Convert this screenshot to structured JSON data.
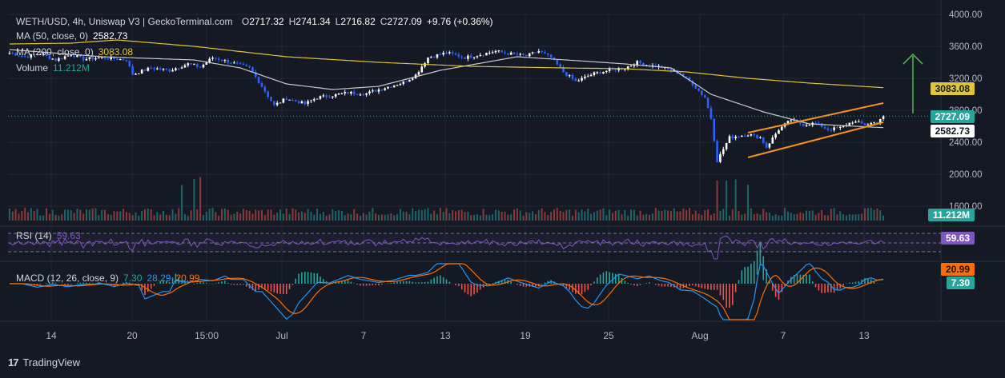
{
  "header": {
    "symbol": "WETH/USD, 4h, Uniswap V3 | GeckoTerminal.com",
    "open_label": "O",
    "open": "2717.32",
    "high_label": "H",
    "high": "2741.34",
    "low_label": "L",
    "low": "2716.82",
    "close_label": "C",
    "close": "2727.09",
    "change": "+9.76 (+0.36%)"
  },
  "legends": {
    "ma50_name": "MA (50, close, 0)",
    "ma50_value": "2582.73",
    "ma200_name": "MA (200, close, 0)",
    "ma200_value": "3083.08",
    "volume_name": "Volume",
    "volume_value": "11.212M",
    "rsi_name": "RSI (14)",
    "rsi_value": "59.63",
    "macd_name": "MACD (12, 26, close, 9)",
    "macd_value": "7.30",
    "signal_value": "28.29",
    "hist_value": "20.99"
  },
  "badges": {
    "ma200": "3083.08",
    "last": "2727.09",
    "ma50": "2582.73",
    "volume": "11.212M",
    "rsi": "59.63",
    "macd_a": "20.99",
    "macd_b": "7.30"
  },
  "brand": {
    "name": "TradingView"
  },
  "colors": {
    "background": "#151924",
    "up": "#ffffff",
    "down": "#2962ff",
    "ma50": "#c8c8c8",
    "ma200": "#e0c43a",
    "channel": "#f7931a",
    "arrow": "#4caf50",
    "rsi": "#7e57c2",
    "macd": "#2196f3",
    "signal": "#ff6d00",
    "hist_up": "#26a69a",
    "hist_down": "#ef5350",
    "grid": "#232734"
  },
  "chart_data": [
    {
      "type": "candlestick",
      "title": "WETH/USD, 4h, Uniswap V3 | GeckoTerminal.com",
      "y_axis_ticks": [
        4000,
        3600,
        3200,
        2800,
        2400,
        2000,
        1600
      ],
      "y_tick_labels": [
        "4000.00",
        "3600.00",
        "3200.00",
        "2800.00",
        "2400.00",
        "2000.00",
        "1600.00"
      ],
      "x_tick_labels": [
        "14",
        "20",
        "15:00",
        "Jul",
        "7",
        "13",
        "19",
        "25",
        "Aug",
        "7",
        "13"
      ],
      "price_path": [
        [
          0,
          3520
        ],
        [
          5,
          3470
        ],
        [
          10,
          3510
        ],
        [
          15,
          3430
        ],
        [
          20,
          3500
        ],
        [
          24,
          3440
        ],
        [
          30,
          3460
        ],
        [
          38,
          3430
        ],
        [
          40,
          3250
        ],
        [
          46,
          3330
        ],
        [
          52,
          3300
        ],
        [
          58,
          3380
        ],
        [
          62,
          3340
        ],
        [
          66,
          3460
        ],
        [
          70,
          3420
        ],
        [
          78,
          3330
        ],
        [
          82,
          3100
        ],
        [
          86,
          2860
        ],
        [
          90,
          2950
        ],
        [
          96,
          2880
        ],
        [
          100,
          2960
        ],
        [
          104,
          2980
        ],
        [
          110,
          3020
        ],
        [
          116,
          3010
        ],
        [
          120,
          3060
        ],
        [
          128,
          3150
        ],
        [
          132,
          3240
        ],
        [
          136,
          3460
        ],
        [
          142,
          3520
        ],
        [
          148,
          3460
        ],
        [
          152,
          3490
        ],
        [
          158,
          3540
        ],
        [
          162,
          3510
        ],
        [
          168,
          3480
        ],
        [
          172,
          3540
        ],
        [
          176,
          3460
        ],
        [
          180,
          3280
        ],
        [
          184,
          3160
        ],
        [
          190,
          3260
        ],
        [
          196,
          3310
        ],
        [
          200,
          3330
        ],
        [
          204,
          3400
        ],
        [
          208,
          3360
        ],
        [
          212,
          3340
        ],
        [
          218,
          3260
        ],
        [
          222,
          3130
        ],
        [
          226,
          2960
        ],
        [
          228,
          2700
        ],
        [
          230,
          2170
        ],
        [
          234,
          2460
        ],
        [
          240,
          2500
        ],
        [
          244,
          2460
        ],
        [
          246,
          2340
        ],
        [
          250,
          2560
        ],
        [
          254,
          2680
        ],
        [
          258,
          2620
        ],
        [
          262,
          2640
        ],
        [
          266,
          2560
        ],
        [
          270,
          2580
        ],
        [
          274,
          2660
        ],
        [
          278,
          2620
        ],
        [
          282,
          2660
        ],
        [
          284,
          2727.09
        ]
      ],
      "ma50": [
        [
          0,
          3560
        ],
        [
          30,
          3470
        ],
        [
          60,
          3430
        ],
        [
          75,
          3330
        ],
        [
          90,
          3130
        ],
        [
          105,
          3060
        ],
        [
          120,
          3100
        ],
        [
          140,
          3300
        ],
        [
          165,
          3470
        ],
        [
          185,
          3420
        ],
        [
          200,
          3380
        ],
        [
          215,
          3330
        ],
        [
          228,
          3000
        ],
        [
          245,
          2780
        ],
        [
          260,
          2630
        ],
        [
          275,
          2600
        ],
        [
          284,
          2582.73
        ]
      ],
      "ma200": [
        [
          0,
          3630
        ],
        [
          20,
          3640
        ],
        [
          35,
          3680
        ],
        [
          60,
          3600
        ],
        [
          90,
          3470
        ],
        [
          120,
          3400
        ],
        [
          150,
          3350
        ],
        [
          180,
          3330
        ],
        [
          200,
          3320
        ],
        [
          220,
          3280
        ],
        [
          240,
          3200
        ],
        [
          260,
          3140
        ],
        [
          284,
          3083.08
        ]
      ],
      "channel_upper": [
        [
          240,
          2520
        ],
        [
          284,
          2890
        ]
      ],
      "channel_lower": [
        [
          240,
          2210
        ],
        [
          284,
          2650
        ]
      ],
      "last_price": 2727.09,
      "ma50_last": 2582.73,
      "ma200_last": 3083.08
    },
    {
      "type": "bar",
      "title": "Volume",
      "last_value": "11.212M",
      "spike_bars": [
        56,
        60,
        62,
        236,
        240
      ]
    },
    {
      "type": "line",
      "title": "RSI (14)",
      "last_value": 59.63,
      "band_levels": [
        70,
        50,
        30
      ]
    },
    {
      "type": "line",
      "title": "MACD (12, 26, close, 9)",
      "macd": 7.3,
      "signal": 28.29,
      "histogram": 20.99
    }
  ]
}
